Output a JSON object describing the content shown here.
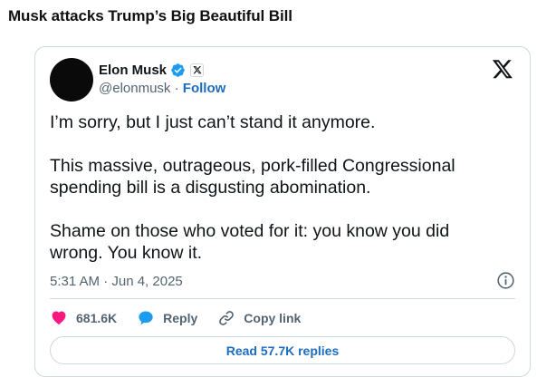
{
  "headline": "Musk attacks Trump’s Big Beautiful Bill",
  "tweet": {
    "author_name": "Elon Musk",
    "handle": "@elonmusk",
    "separator": " · ",
    "follow_label": "Follow",
    "paragraphs": [
      "I’m sorry, but I just can’t stand it anymore.",
      "This massive, outrageous, pork-filled Congressional spending bill is a disgusting abomination.",
      "Shame on those who voted for it: you know you did wrong. You know it."
    ],
    "timestamp": "5:31 AM · Jun 4, 2025",
    "likes": "681.6K",
    "reply_label": "Reply",
    "copy_link_label": "Copy link",
    "read_replies_label": "Read 57.7K replies"
  },
  "colors": {
    "verified_blue": "#1d9bf0",
    "like_pink": "#f91880",
    "link_blue": "#1d6cbf",
    "muted_gray": "#536471",
    "border": "#cfd9de"
  },
  "icons": [
    "verified-badge-icon",
    "x-affiliate-icon",
    "x-logo-icon",
    "info-icon",
    "heart-icon",
    "reply-bubble-icon",
    "link-icon"
  ]
}
